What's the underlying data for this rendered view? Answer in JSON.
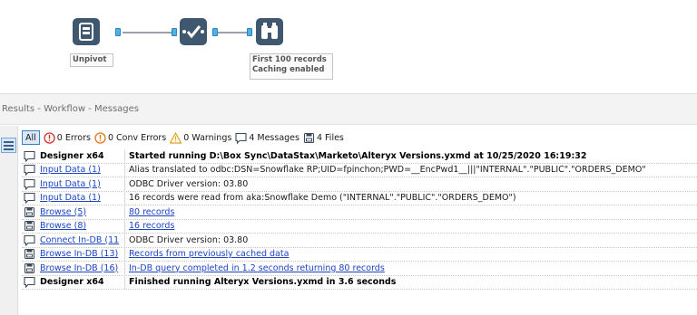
{
  "workflow": {
    "tools": [
      {
        "name": "input-data-tool",
        "icon": "database-icon",
        "color": "#3f5870"
      },
      {
        "name": "unpivot-tool",
        "icon": "checkmark-transform-icon",
        "color": "#3f5870"
      },
      {
        "name": "browse-tool",
        "icon": "binoculars-icon",
        "color": "#3f5870"
      }
    ],
    "annotations": {
      "unpivot": "Unpivot",
      "browse_line1": "First 100 records",
      "browse_line2": "Caching enabled"
    }
  },
  "results": {
    "title": "Results - Workflow - Messages",
    "filters": {
      "all": "All",
      "errors": "0 Errors",
      "conv_errors": "0 Conv Errors",
      "warnings": "0 Warnings",
      "messages": "4 Messages",
      "files": "4 Files"
    },
    "rows": [
      {
        "icon": "message-icon",
        "tool": "Designer x64",
        "tool_link": false,
        "message": "Started running D:\\Box Sync\\DataStax\\Marketo\\Alteryx Versions.yxmd at 10/25/2020 16:19:32",
        "msg_link": false,
        "bold": true
      },
      {
        "icon": "message-icon",
        "tool": "Input Data (1)",
        "tool_link": true,
        "message": "Alias translated to odbc:DSN=Snowflake RP;UID=fpinchon;PWD=__EncPwd1__|||\"INTERNAL\".\"PUBLIC\".\"ORDERS_DEMO\"",
        "msg_link": false,
        "bold": false
      },
      {
        "icon": "message-icon",
        "tool": "Input Data (1)",
        "tool_link": true,
        "message": "ODBC Driver version: 03.80",
        "msg_link": false,
        "bold": false
      },
      {
        "icon": "message-icon",
        "tool": "Input Data (1)",
        "tool_link": true,
        "message": "16 records were read from aka:Snowflake Demo (\"INTERNAL\".\"PUBLIC\".\"ORDERS_DEMO\")",
        "msg_link": false,
        "bold": false
      },
      {
        "icon": "file-icon",
        "tool": "Browse (5)",
        "tool_link": true,
        "message": "80 records",
        "msg_link": true,
        "bold": false
      },
      {
        "icon": "file-icon",
        "tool": "Browse (8)",
        "tool_link": true,
        "message": "16 records",
        "msg_link": true,
        "bold": false
      },
      {
        "icon": "message-icon",
        "tool": "Connect In-DB (11",
        "tool_link": true,
        "message": "ODBC Driver version: 03.80",
        "msg_link": false,
        "bold": false
      },
      {
        "icon": "file-icon",
        "tool": "Browse In-DB (13)",
        "tool_link": true,
        "message": "Records from previously cached data",
        "msg_link": true,
        "bold": false
      },
      {
        "icon": "file-icon",
        "tool": "Browse In-DB (16)",
        "tool_link": true,
        "message": "In-DB query completed in 1.2 seconds returning 80 records",
        "msg_link": true,
        "bold": false
      },
      {
        "icon": "message-icon",
        "tool": "Designer x64",
        "tool_link": false,
        "message": "Finished running Alteryx Versions.yxmd in 3.6 seconds",
        "msg_link": false,
        "bold": true
      }
    ]
  }
}
